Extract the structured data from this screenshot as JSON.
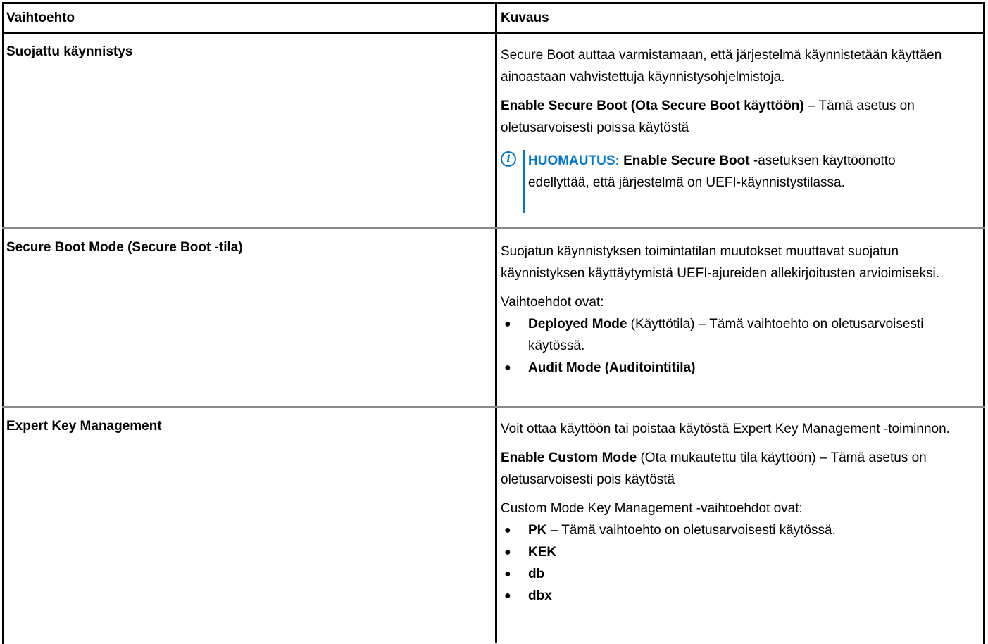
{
  "table": {
    "header": {
      "option": "Vaihtoehto",
      "description": "Kuvaus"
    },
    "rows": [
      {
        "option": "Suojattu käynnistys",
        "desc_p1": "Secure Boot auttaa varmistamaan, että järjestelmä käynnistetään käyttäen ainoastaan vahvistettuja käynnistysohjelmistoja.",
        "desc_p2_bold": "Enable Secure Boot (Ota Secure Boot käyttöön)",
        "desc_p2_rest": " – Tämä asetus on oletusarvoisesti poissa käytöstä",
        "note": {
          "label": "HUOMAUTUS:",
          "bold": "Enable Secure Boot",
          "rest": " -asetuksen käyttöönotto edellyttää, että järjestelmä on UEFI-käynnistystilassa."
        }
      },
      {
        "option": "Secure Boot Mode (Secure Boot -tila)",
        "desc_p1": "Suojatun käynnistyksen toimintatilan muutokset muuttavat suojatun käynnistyksen käyttäytymistä UEFI-ajureiden allekirjoitusten arvioimiseksi.",
        "desc_p2": "Vaihtoehdot ovat:",
        "bullets": [
          {
            "bold": "Deployed Mode",
            "rest": " (Käyttötila) – Tämä vaihtoehto on oletusarvoisesti käytössä."
          },
          {
            "bold": "Audit Mode (Auditointitila)",
            "rest": ""
          }
        ]
      },
      {
        "option": "Expert Key Management",
        "desc_p1": "Voit ottaa käyttöön tai poistaa käytöstä Expert Key Management -toiminnon.",
        "desc_p2_bold": "Enable Custom Mode",
        "desc_p2_rest": " (Ota mukautettu tila käyttöön) – Tämä asetus on oletusarvoisesti pois käytöstä",
        "desc_p3": "Custom Mode Key Management -vaihtoehdot ovat:",
        "bullets": [
          {
            "bold": "PK",
            "rest": " – Tämä vaihtoehto on oletusarvoisesti käytössä."
          },
          {
            "bold": "KEK",
            "rest": ""
          },
          {
            "bold": "db",
            "rest": ""
          },
          {
            "bold": "dbx",
            "rest": ""
          }
        ]
      }
    ]
  },
  "colors": {
    "border": "#000000",
    "row_divider": "#8a8a8a",
    "note_accent": "#0076ce"
  },
  "icons": {
    "note": "info-circle-icon"
  }
}
